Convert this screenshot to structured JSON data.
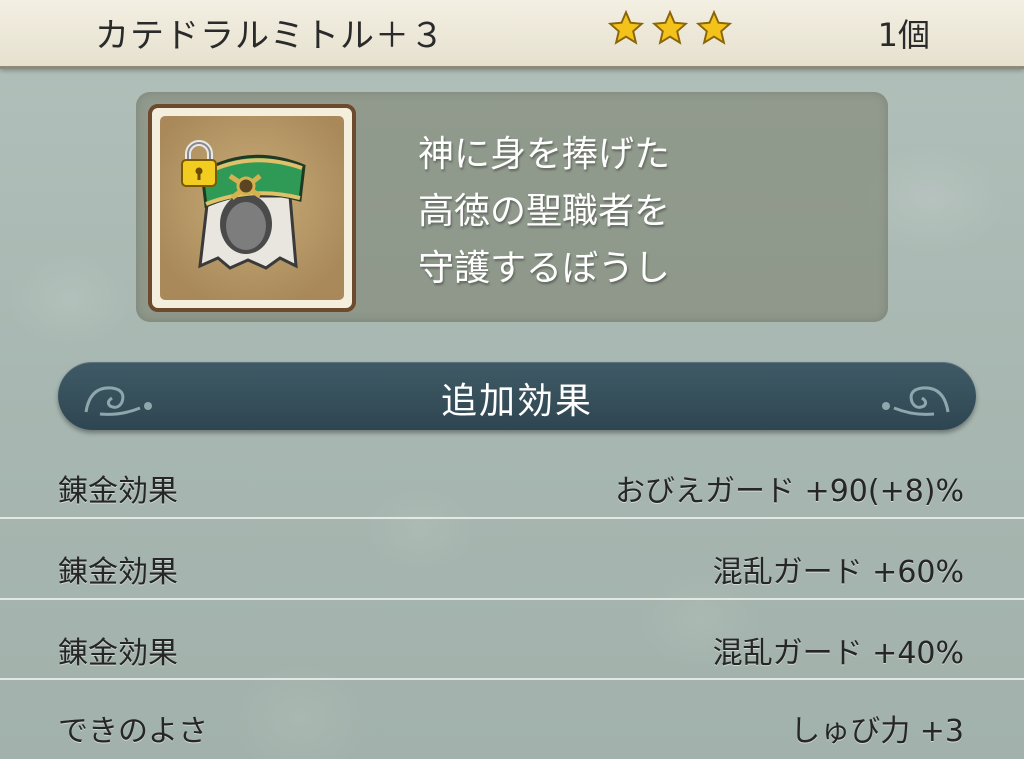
{
  "header": {
    "title": "カテドラルミトル＋３",
    "star_rating": 3,
    "star_color": "#f3c31b",
    "count": "1個"
  },
  "item": {
    "icon": "green-mitre-hat-icon",
    "locked": true,
    "description": "神に身を捧げた\n高徳の聖職者を\n守護するぼうし"
  },
  "section": {
    "title": "追加効果"
  },
  "effects": [
    {
      "label": "錬金効果",
      "value": "おびえガード +90(+8)%"
    },
    {
      "label": "錬金効果",
      "value": "混乱ガード +60%"
    },
    {
      "label": "錬金効果",
      "value": "混乱ガード +40%"
    },
    {
      "label": "できのよさ",
      "value": "しゅび力 +3"
    }
  ]
}
